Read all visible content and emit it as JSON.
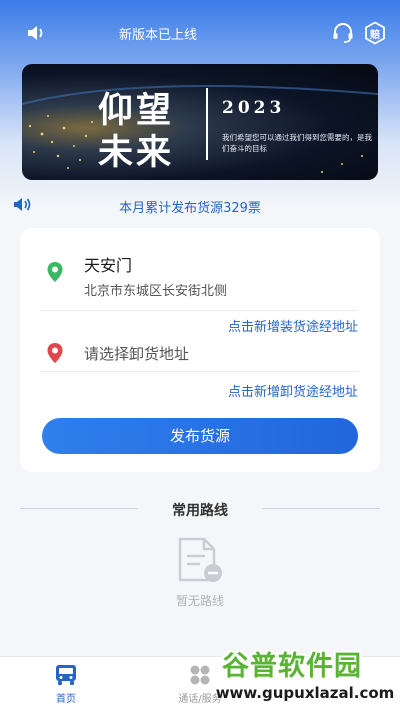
{
  "top_bar": {
    "title": "新版本已上线",
    "badge_text": "赔"
  },
  "banner": {
    "line1": "仰望",
    "line2": "未来",
    "year": "2023",
    "subtitle": "我们希望您可以通过我们得到您需要的，是我们奋斗的目标"
  },
  "notice": {
    "text": "本月累计发布货源329票"
  },
  "route_card": {
    "load_name": "天安门",
    "load_address": "北京市东城区长安街北侧",
    "add_load_link": "点击新增装货途经地址",
    "unload_placeholder": "请选择卸货地址",
    "add_unload_link": "点击新增卸货途经地址",
    "publish_button": "发布货源"
  },
  "common_routes": {
    "title": "常用路线",
    "empty_text": "暂无路线"
  },
  "bottom_nav": {
    "items": [
      {
        "label": "首页",
        "icon": "truck-icon",
        "active": true
      },
      {
        "label": "通话/服务",
        "icon": "grid-icon",
        "active": false
      }
    ]
  },
  "watermark": {
    "title": "谷普软件园",
    "url": "www.gupuxlazal.com"
  },
  "colors": {
    "primary": "#2465c8",
    "button": "#2f7fee",
    "green_pin": "#3cb865",
    "red_pin": "#e0474c"
  }
}
